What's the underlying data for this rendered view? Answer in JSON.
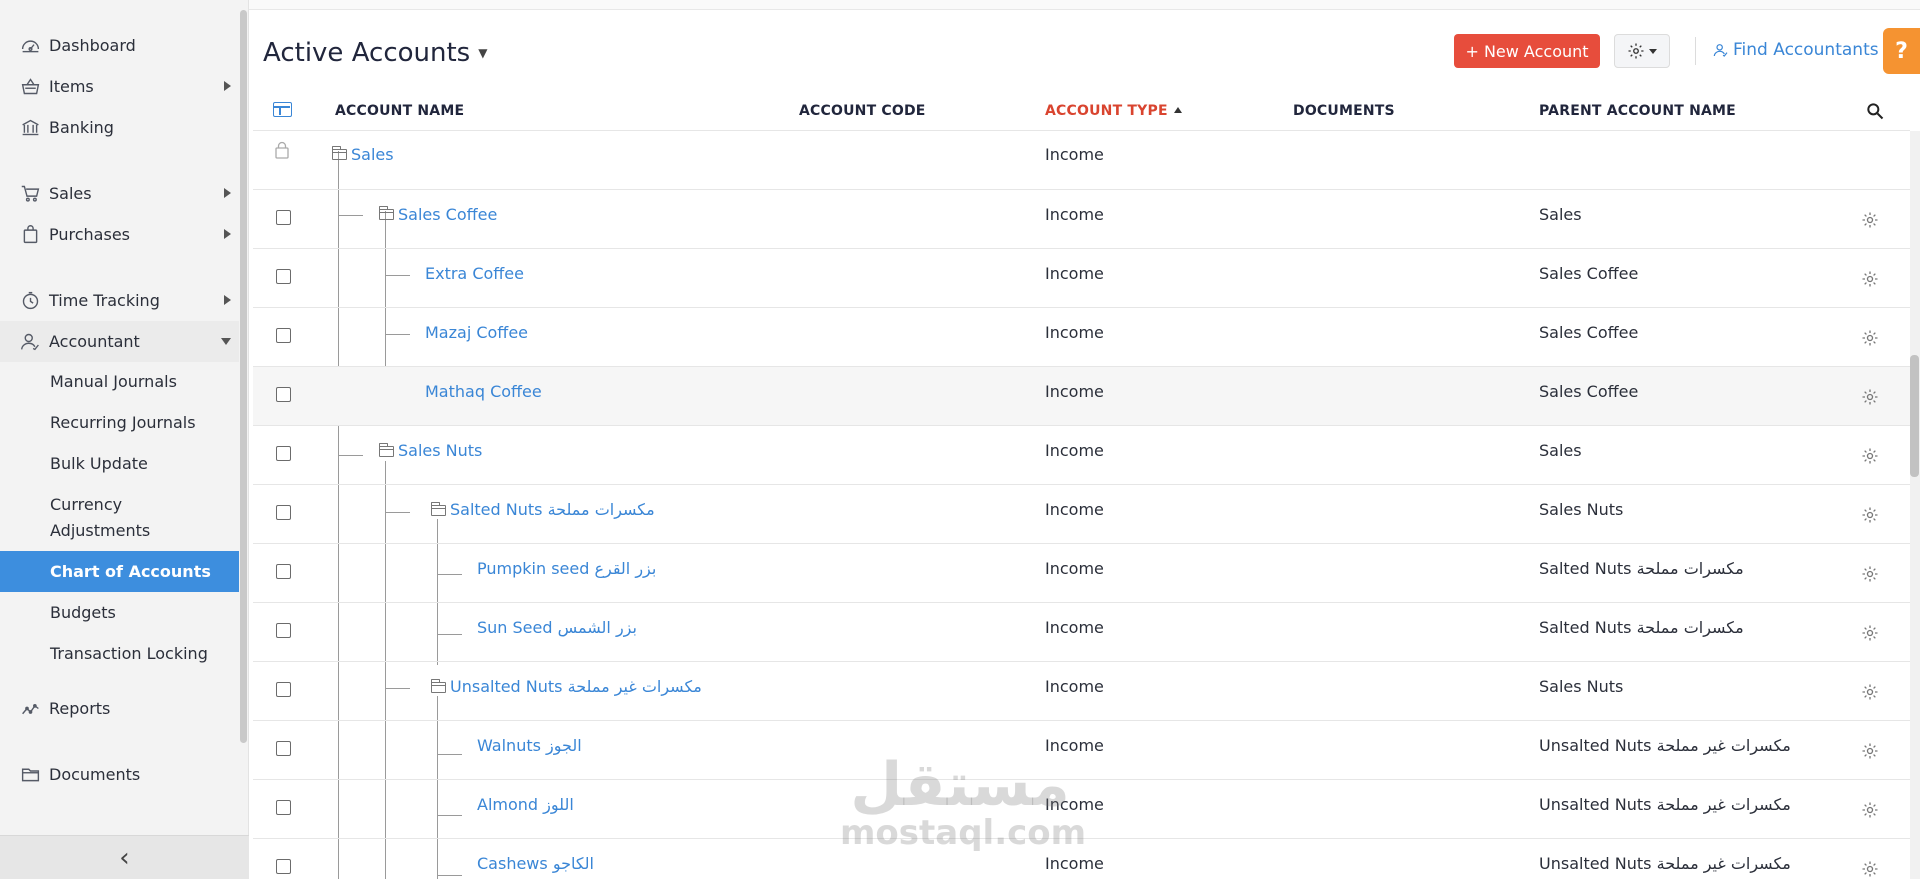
{
  "sidebar": {
    "items": [
      {
        "label": "Dashboard",
        "icon": "dashboard-icon"
      },
      {
        "label": "Items",
        "icon": "items-basket-icon"
      },
      {
        "label": "Banking",
        "icon": "bank-icon"
      },
      {
        "label": "Sales",
        "icon": "cart-icon"
      },
      {
        "label": "Purchases",
        "icon": "bag-icon"
      },
      {
        "label": "Time Tracking",
        "icon": "stopwatch-icon"
      },
      {
        "label": "Accountant",
        "icon": "accountant-icon"
      },
      {
        "label": "Reports",
        "icon": "reports-icon"
      },
      {
        "label": "Documents",
        "icon": "folder-icon"
      }
    ],
    "accountant_sub": [
      {
        "label": "Manual Journals"
      },
      {
        "label": "Recurring Journals"
      },
      {
        "label": "Bulk Update"
      },
      {
        "label": "Currency Adjustments"
      },
      {
        "label": "Chart of Accounts",
        "active": true
      },
      {
        "label": "Budgets"
      },
      {
        "label": "Transaction Locking"
      }
    ],
    "collapse_glyph": "‹"
  },
  "header": {
    "title": "Active Accounts",
    "new_account": "+ New Account",
    "find_accountants": "Find Accountants",
    "help": "?"
  },
  "table": {
    "columns": [
      "ACCOUNT NAME",
      "ACCOUNT CODE",
      "ACCOUNT TYPE",
      "DOCUMENTS",
      "PARENT ACCOUNT NAME"
    ],
    "sorted_column": "ACCOUNT TYPE",
    "rows": [
      {
        "name": "Sales",
        "type": "Income",
        "parent": "",
        "level": 0,
        "folder": true,
        "locked": true
      },
      {
        "name": "Sales Coffee",
        "type": "Income",
        "parent": "Sales",
        "level": 1,
        "folder": true
      },
      {
        "name": "Extra Coffee",
        "type": "Income",
        "parent": "Sales Coffee",
        "level": 2,
        "folder": false
      },
      {
        "name": "Mazaj Coffee",
        "type": "Income",
        "parent": "Sales Coffee",
        "level": 2,
        "folder": false
      },
      {
        "name": "Mathaq Coffee",
        "type": "Income",
        "parent": "Sales Coffee",
        "level": 2,
        "folder": false
      },
      {
        "name": "Sales Nuts",
        "type": "Income",
        "parent": "Sales",
        "level": 1,
        "folder": true
      },
      {
        "name": "Salted Nuts مكسرات مملحة",
        "type": "Income",
        "parent": "Sales Nuts",
        "level": 2,
        "folder": true
      },
      {
        "name": "Pumpkin seed بزر القرع",
        "type": "Income",
        "parent": "Salted Nuts مكسرات مملحة",
        "level": 3,
        "folder": false
      },
      {
        "name": "Sun Seed بزر الشمس",
        "type": "Income",
        "parent": "Salted Nuts مكسرات مملحة",
        "level": 3,
        "folder": false
      },
      {
        "name": "Unsalted Nuts مكسرات غير مملحة",
        "type": "Income",
        "parent": "Sales Nuts",
        "level": 2,
        "folder": true
      },
      {
        "name": "Walnuts الجوز",
        "type": "Income",
        "parent": "Unsalted Nuts مكسرات غير مملحة",
        "level": 3,
        "folder": false
      },
      {
        "name": "Almond اللوز",
        "type": "Income",
        "parent": "Unsalted Nuts مكسرات غير مملحة",
        "level": 3,
        "folder": false
      },
      {
        "name": "Cashews الكاجو",
        "type": "Income",
        "parent": "Unsalted Nuts مكسرات غير مملحة",
        "level": 3,
        "folder": false
      }
    ]
  },
  "watermark": {
    "logo": "مستقل",
    "url": "mostaql.com"
  },
  "colors": {
    "accent": "#3a86d6",
    "new_button": "#e74d3c",
    "help": "#f59331",
    "active_nav": "#3d8ede",
    "sorted_header": "#d9442f"
  }
}
